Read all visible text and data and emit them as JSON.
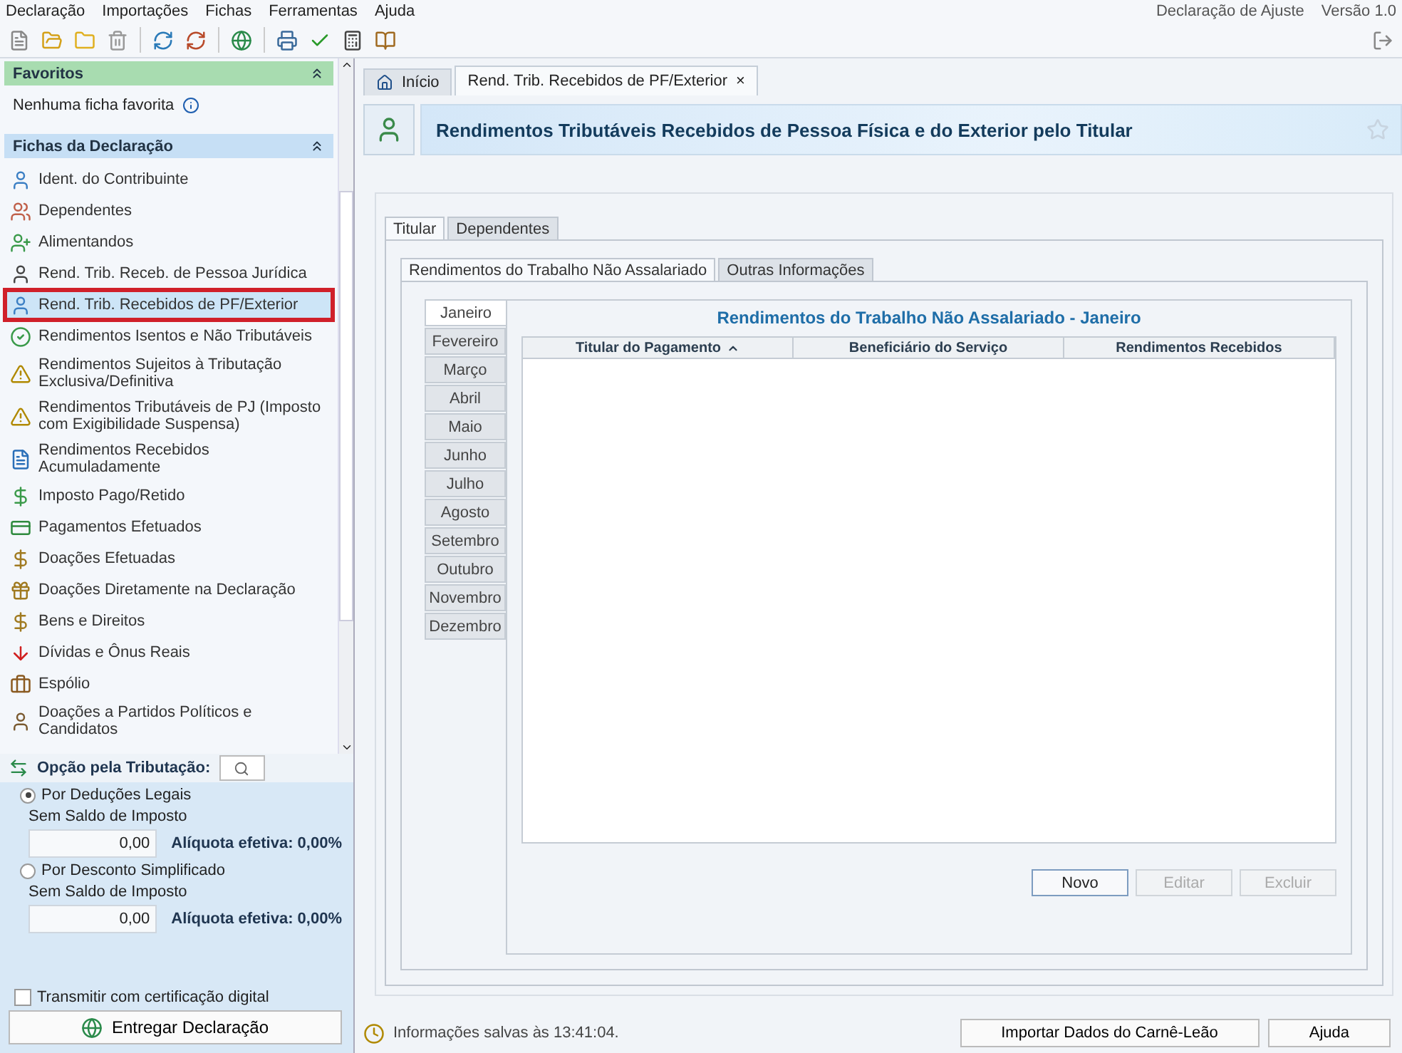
{
  "menu": [
    "Declaração",
    "Importações",
    "Fichas",
    "Ferramentas",
    "Ajuda"
  ],
  "header_right": {
    "mode": "Declaração de Ajuste",
    "version": "Versão 1.0"
  },
  "favorites": {
    "title": "Favoritos",
    "empty_text": "Nenhuma ficha favorita"
  },
  "fichas": {
    "title": "Fichas da Declaração",
    "items": [
      {
        "label": "Ident. do Contribuinte",
        "selected": false
      },
      {
        "label": "Dependentes",
        "selected": false
      },
      {
        "label": "Alimentandos",
        "selected": false
      },
      {
        "label": "Rend. Trib. Receb. de Pessoa Jurídica",
        "selected": false
      },
      {
        "label": "Rend. Trib. Recebidos de PF/Exterior",
        "selected": true
      },
      {
        "label": "Rendimentos Isentos e Não Tributáveis",
        "selected": false
      },
      {
        "label": "Rendimentos Sujeitos à Tributação Exclusiva/Definitiva",
        "selected": false
      },
      {
        "label": "Rendimentos Tributáveis de PJ (Imposto com Exigibilidade Suspensa)",
        "selected": false
      },
      {
        "label": "Rendimentos Recebidos Acumuladamente",
        "selected": false
      },
      {
        "label": "Imposto Pago/Retido",
        "selected": false
      },
      {
        "label": "Pagamentos Efetuados",
        "selected": false
      },
      {
        "label": "Doações Efetuadas",
        "selected": false
      },
      {
        "label": "Doações Diretamente na Declaração",
        "selected": false
      },
      {
        "label": "Bens e Direitos",
        "selected": false
      },
      {
        "label": "Dívidas e Ônus Reais",
        "selected": false
      },
      {
        "label": "Espólio",
        "selected": false
      },
      {
        "label": "Doações a Partidos Políticos e Candidatos",
        "selected": false
      }
    ]
  },
  "tributacao": {
    "title": "Opção pela Tributação:",
    "options": [
      {
        "label": "Por Deduções Legais",
        "selected": true,
        "status": "Sem Saldo de Imposto",
        "value": "0,00",
        "rate": "Alíquota efetiva: 0,00%"
      },
      {
        "label": "Por Desconto Simplificado",
        "selected": false,
        "status": "Sem Saldo de Imposto",
        "value": "0,00",
        "rate": "Alíquota efetiva: 0,00%"
      }
    ],
    "certificate": {
      "label": "Transmitir com certificação digital",
      "checked": false
    },
    "submit": "Entregar Declaração"
  },
  "doc_tabs": [
    {
      "label": "Início",
      "selected": false,
      "closable": false
    },
    {
      "label": "Rend. Trib. Recebidos de PF/Exterior",
      "selected": true,
      "closable": true
    }
  ],
  "close_glyph": "×",
  "page_title": "Rendimentos Tributáveis Recebidos de Pessoa Física e do Exterior pelo Titular",
  "person_tabs": [
    {
      "label": "Titular",
      "selected": true
    },
    {
      "label": "Dependentes",
      "selected": false
    }
  ],
  "sub_tabs": [
    {
      "label": "Rendimentos do Trabalho Não Assalariado",
      "selected": true
    },
    {
      "label": "Outras Informações",
      "selected": false
    }
  ],
  "months": [
    {
      "label": "Janeiro",
      "selected": true
    },
    {
      "label": "Fevereiro",
      "selected": false
    },
    {
      "label": "Março",
      "selected": false
    },
    {
      "label": "Abril",
      "selected": false
    },
    {
      "label": "Maio",
      "selected": false
    },
    {
      "label": "Junho",
      "selected": false
    },
    {
      "label": "Julho",
      "selected": false
    },
    {
      "label": "Agosto",
      "selected": false
    },
    {
      "label": "Setembro",
      "selected": false
    },
    {
      "label": "Outubro",
      "selected": false
    },
    {
      "label": "Novembro",
      "selected": false
    },
    {
      "label": "Dezembro",
      "selected": false
    }
  ],
  "panel_title": "Rendimentos do Trabalho Não Assalariado - Janeiro",
  "table": {
    "columns": [
      {
        "label": "Titular do Pagamento",
        "sorted": true
      },
      {
        "label": "Beneficiário do Serviço",
        "sorted": false
      },
      {
        "label": "Rendimentos Recebidos",
        "sorted": false
      }
    ]
  },
  "actions": [
    {
      "label": "Novo",
      "disabled": false
    },
    {
      "label": "Editar",
      "disabled": true
    },
    {
      "label": "Excluir",
      "disabled": true
    }
  ],
  "status": "Informações salvas às 13:41:04.",
  "footer_buttons": [
    "Importar Dados do Carnê-Leão",
    "Ajuda"
  ]
}
